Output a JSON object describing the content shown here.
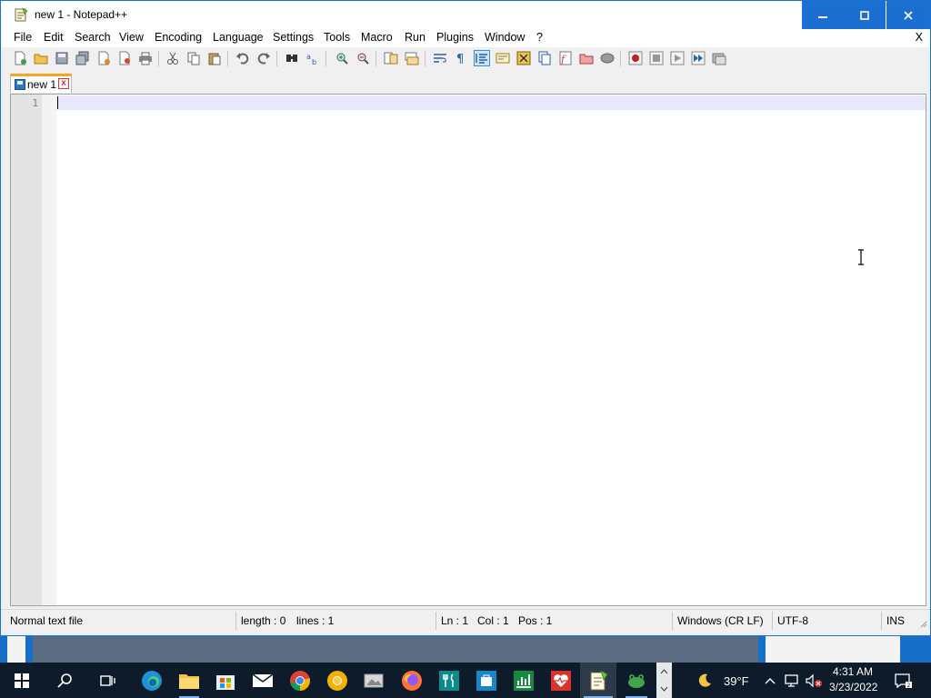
{
  "window": {
    "title": "new 1 - Notepad++"
  },
  "menu": {
    "items": [
      {
        "label": "File"
      },
      {
        "label": "Edit"
      },
      {
        "label": "Search"
      },
      {
        "label": "View"
      },
      {
        "label": "Encoding"
      },
      {
        "label": "Language"
      },
      {
        "label": "Settings"
      },
      {
        "label": "Tools"
      },
      {
        "label": "Macro"
      },
      {
        "label": "Run"
      },
      {
        "label": "Plugins"
      },
      {
        "label": "Window"
      },
      {
        "label": "?"
      }
    ],
    "close_label": "X"
  },
  "toolbar": {
    "icons": [
      "new-file-icon",
      "open-file-icon",
      "save-icon",
      "save-all-icon",
      "close-icon",
      "close-all-icon",
      "print-icon",
      "cut-icon",
      "copy-icon",
      "paste-icon",
      "undo-icon",
      "redo-icon",
      "find-icon",
      "replace-icon",
      "zoom-in-icon",
      "zoom-out-icon",
      "sync-vertical-icon",
      "sync-horizontal-icon",
      "word-wrap-icon",
      "show-all-chars-icon",
      "indent-guide-icon",
      "udl-icon",
      "doc-map-icon",
      "doc-list-icon",
      "function-list-icon",
      "folder-workspace-icon",
      "monitoring-icon",
      "record-macro-icon",
      "stop-macro-icon",
      "play-macro-icon",
      "run-macro-multiple-icon",
      "save-macro-icon"
    ],
    "active_icon": "indent-guide-icon"
  },
  "tabs": [
    {
      "label": "new 1",
      "close_label": "x"
    }
  ],
  "editor": {
    "line_numbers": [
      "1"
    ],
    "content": ""
  },
  "statusbar": {
    "file_type": "Normal text file",
    "length": "length : 0",
    "lines": "lines : 1",
    "ln": "Ln : 1",
    "col": "Col : 1",
    "pos": "Pos : 1",
    "eol": "Windows (CR LF)",
    "encoding": "UTF-8",
    "mode": "INS"
  },
  "taskbar": {
    "apps": [
      "start-icon",
      "search-icon",
      "task-view-icon",
      "edge-icon",
      "file-explorer-icon",
      "store-icon",
      "mail-icon",
      "chrome-icon",
      "chrome-canary-icon",
      "photos-icon",
      "firefox-icon",
      "restaurant-app-icon",
      "store-bag-app-icon",
      "chart-app-icon",
      "health-app-icon",
      "notepadpp-icon",
      "frog-app-icon"
    ],
    "weather_icon": "moon-icon",
    "temperature": "39°F",
    "time": "4:31 AM",
    "date": "3/23/2022"
  },
  "colors": {
    "title_buttons": "#1b6fd0",
    "taskbar": "#0d1b2a",
    "tab_accent": "#f5a623",
    "current_line": "#e8e8ff"
  }
}
